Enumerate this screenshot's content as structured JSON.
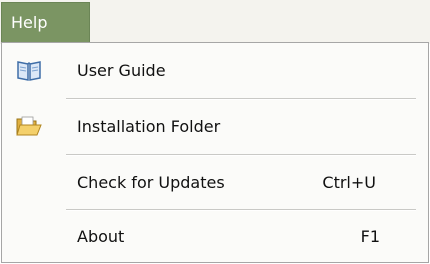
{
  "menubar": {
    "active_menu": "Help"
  },
  "menu": {
    "items": [
      {
        "label": "User Guide",
        "shortcut": "",
        "icon": "book-icon"
      },
      {
        "label": "Installation Folder",
        "shortcut": "",
        "icon": "folder-icon"
      },
      {
        "label": "Check for Updates",
        "shortcut": "Ctrl+U",
        "icon": ""
      },
      {
        "label": "About",
        "shortcut": "F1",
        "icon": ""
      }
    ]
  },
  "colors": {
    "menubar_active_bg": "#7b9563",
    "menu_bg": "#fbfbf9",
    "menu_border": "#a6a6a6"
  }
}
